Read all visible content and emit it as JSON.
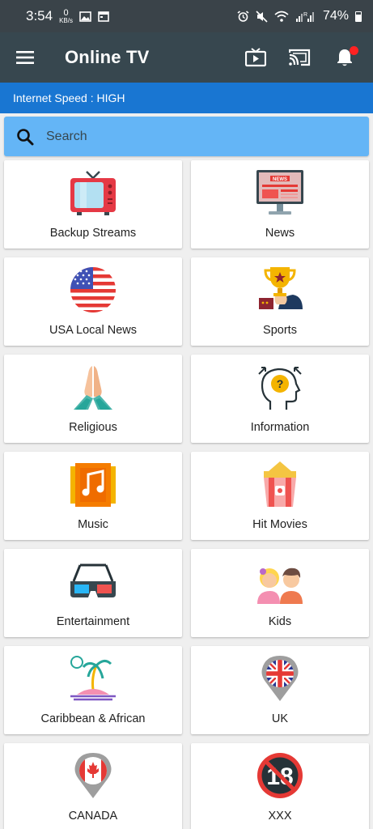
{
  "status": {
    "time": "3:54",
    "kbs_value": "0",
    "kbs_unit": "KB/s",
    "battery": "74%"
  },
  "appbar": {
    "title": "Online TV"
  },
  "speed": {
    "text": "Internet Speed : HIGH"
  },
  "search": {
    "placeholder": "Search"
  },
  "colors": {
    "appbar": "#37474f",
    "speedbar": "#1976d2",
    "search": "#64b5f6",
    "notification_dot": "#ff2222"
  },
  "categories": [
    {
      "label": "Backup Streams",
      "icon": "retro-tv-icon"
    },
    {
      "label": "News",
      "icon": "news-monitor-icon"
    },
    {
      "label": "USA Local News",
      "icon": "usa-flag-icon"
    },
    {
      "label": "Sports",
      "icon": "trophy-icon"
    },
    {
      "label": "Religious",
      "icon": "praying-hands-icon"
    },
    {
      "label": "Information",
      "icon": "head-question-icon"
    },
    {
      "label": "Music",
      "icon": "music-note-icon"
    },
    {
      "label": "Hit Movies",
      "icon": "popcorn-icon"
    },
    {
      "label": "Entertainment",
      "icon": "3d-glasses-icon"
    },
    {
      "label": "Kids",
      "icon": "kids-icon"
    },
    {
      "label": "Caribbean & African",
      "icon": "palm-island-icon"
    },
    {
      "label": "UK",
      "icon": "uk-pin-icon"
    },
    {
      "label": "CANADA",
      "icon": "canada-pin-icon"
    },
    {
      "label": "XXX",
      "icon": "adults-only-18-icon"
    }
  ]
}
